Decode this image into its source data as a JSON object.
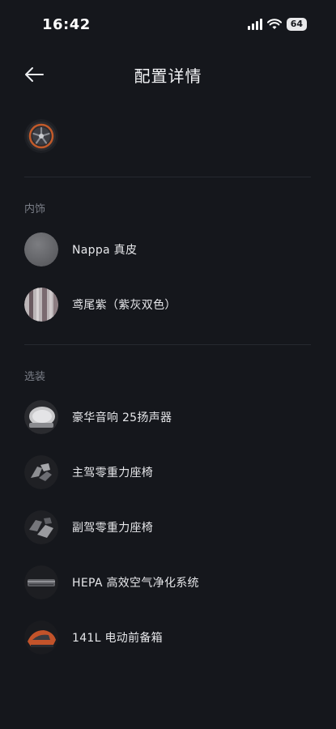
{
  "status_bar": {
    "time": "16:42",
    "battery": "64"
  },
  "nav": {
    "title": "配置详情"
  },
  "sections": {
    "interior": {
      "title": "内饰",
      "items": [
        {
          "label": "Nappa 真皮"
        },
        {
          "label": "鸢尾紫（紫灰双色）"
        }
      ]
    },
    "options": {
      "title": "选装",
      "items": [
        {
          "label": "豪华音响 25扬声器"
        },
        {
          "label": "主驾零重力座椅"
        },
        {
          "label": "副驾零重力座椅"
        },
        {
          "label": "HEPA 高效空气净化系统"
        },
        {
          "label": "141L 电动前备箱"
        }
      ]
    }
  },
  "icons": {
    "back": "arrow-left-icon",
    "wheel": "wheel-thumbnail",
    "signal": "signal-icon",
    "wifi": "wifi-icon"
  },
  "colors": {
    "background": "#15171c",
    "text": "#e9eaee",
    "muted": "#7b7f88",
    "divider": "#262930"
  }
}
